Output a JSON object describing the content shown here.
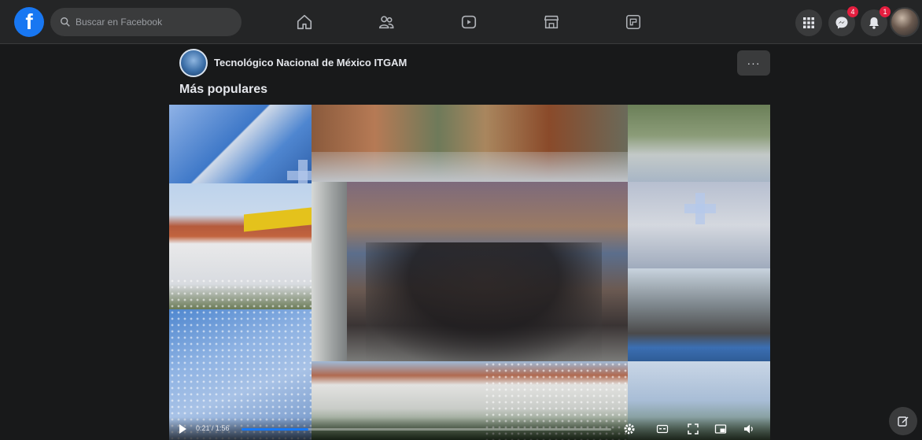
{
  "topbar": {
    "logo": "f",
    "search": {
      "placeholder": "Buscar en Facebook",
      "value": ""
    },
    "nav_icons": [
      "home-icon",
      "groups-icon",
      "watch-icon",
      "marketplace-icon",
      "gaming-icon"
    ],
    "right_buttons": [
      {
        "icon": "menu-grid-icon",
        "badge": ""
      },
      {
        "icon": "messenger-icon",
        "badge": "4"
      },
      {
        "icon": "notifications-icon",
        "badge": "1"
      }
    ]
  },
  "post": {
    "page_name": "Tecnológico Nacional de México ITGAM",
    "more_label": "···",
    "section_title": "Más populares"
  },
  "player": {
    "time": "0:21 / 1:56",
    "progress": 0.18
  },
  "colors": {
    "accent": "#1877f2",
    "badge": "#e41e3f",
    "surface": "#242526",
    "background": "#18191a"
  }
}
